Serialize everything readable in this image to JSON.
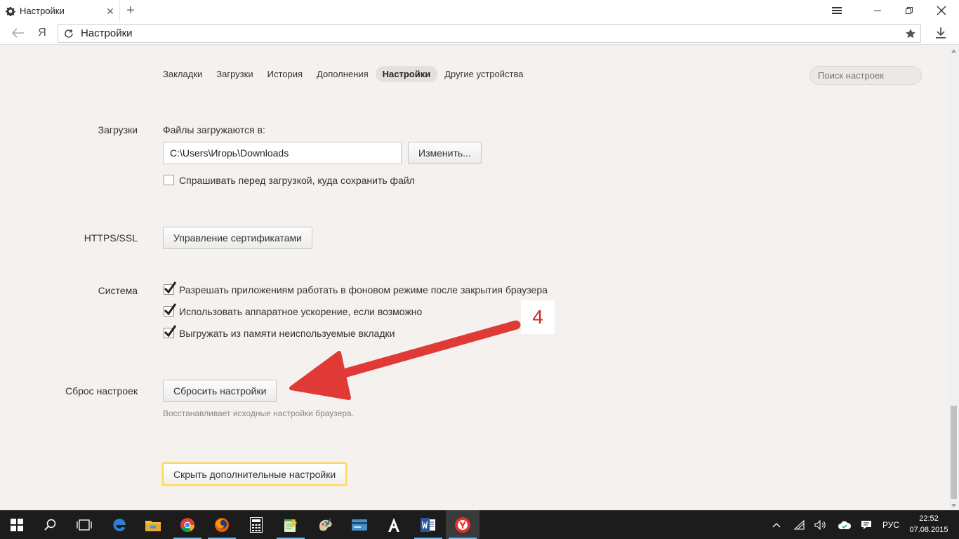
{
  "browser": {
    "tab_title": "Настройки",
    "address_url": "Настройки",
    "ya_label": "Я"
  },
  "settings_nav": {
    "items": [
      {
        "label": "Закладки",
        "active": false
      },
      {
        "label": "Загрузки",
        "active": false
      },
      {
        "label": "История",
        "active": false
      },
      {
        "label": "Дополнения",
        "active": false
      },
      {
        "label": "Настройки",
        "active": true
      },
      {
        "label": "Другие устройства",
        "active": false
      }
    ],
    "search_placeholder": "Поиск настроек"
  },
  "downloads": {
    "section_label": "Загрузки",
    "location_label": "Файлы загружаются в:",
    "path_value": "C:\\Users\\Игорь\\Downloads",
    "change_button": "Изменить...",
    "ask_checkbox": {
      "label": "Спрашивать перед загрузкой, куда сохранить файл",
      "checked": false
    }
  },
  "https": {
    "section_label": "HTTPS/SSL",
    "manage_button": "Управление сертификатами"
  },
  "system": {
    "section_label": "Система",
    "options": [
      {
        "label": "Разрешать приложениям работать в фоновом режиме после закрытия браузера",
        "checked": true
      },
      {
        "label": "Использовать аппаратное ускорение, если возможно",
        "checked": true
      },
      {
        "label": "Выгружать из памяти неиспользуемые вкладки",
        "checked": true
      }
    ]
  },
  "reset": {
    "section_label": "Сброс настроек",
    "reset_button": "Сбросить настройки",
    "hint": "Восстанавливает исходные настройки браузера."
  },
  "hide_advanced_button": "Скрыть дополнительные настройки",
  "annotation": {
    "number": "4",
    "color": "#e03a36"
  },
  "taskbar": {
    "apps": [
      "start-icon",
      "search-icon",
      "task-view-icon",
      "edge-icon",
      "file-explorer-icon",
      "chrome-icon",
      "firefox-icon",
      "calculator-icon",
      "notepad-icon",
      "paint-icon",
      "card-app-icon",
      "font-app-icon",
      "word-icon",
      "yandex-browser-icon"
    ],
    "language": "РУС",
    "time": "22:52",
    "date": "07.08.2015"
  }
}
